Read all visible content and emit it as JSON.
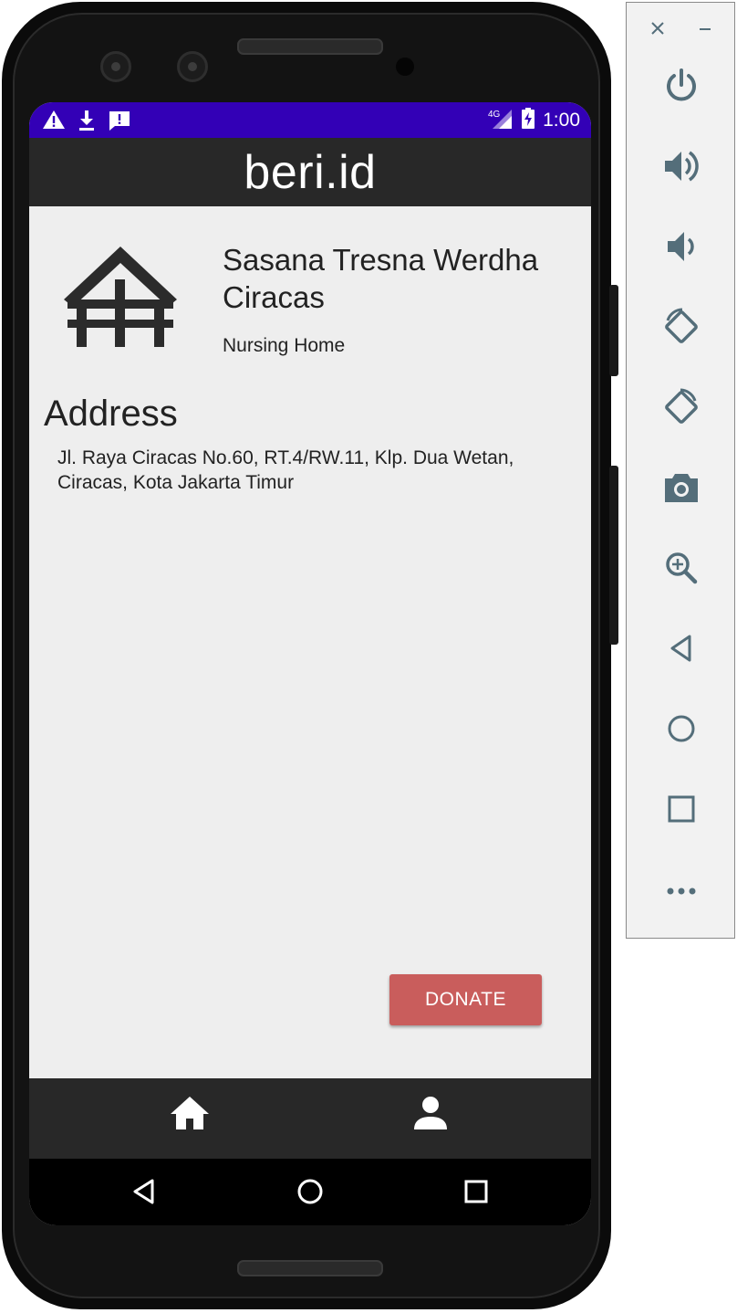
{
  "status_bar": {
    "time": "1:00",
    "network": "4G",
    "color": "#3300b6"
  },
  "app_bar": {
    "title": "beri.id",
    "color": "#282828"
  },
  "place": {
    "name": "Sasana Tresna Werdha Ciracas",
    "type": "Nursing Home",
    "icon": "house-icon"
  },
  "address": {
    "heading": "Address",
    "text": "Jl. Raya Ciracas No.60, RT.4/RW.11, Klp. Dua Wetan, Ciracas, Kota Jakarta Timur"
  },
  "actions": {
    "donate_label": "DONATE",
    "donate_color": "#c95d5c"
  },
  "bottom_nav": {
    "items": [
      {
        "icon": "home-icon",
        "selected": true
      },
      {
        "icon": "person-icon",
        "selected": false
      }
    ]
  },
  "emulator_panel": {
    "controls": [
      "close-icon",
      "minimize-icon"
    ],
    "buttons": [
      "power-icon",
      "volume-up-icon",
      "volume-down-icon",
      "rotate-left-icon",
      "rotate-right-icon",
      "camera-icon",
      "zoom-icon",
      "back-icon",
      "home-circle-icon",
      "overview-icon",
      "more-icon"
    ],
    "icon_color": "#546e7a"
  }
}
